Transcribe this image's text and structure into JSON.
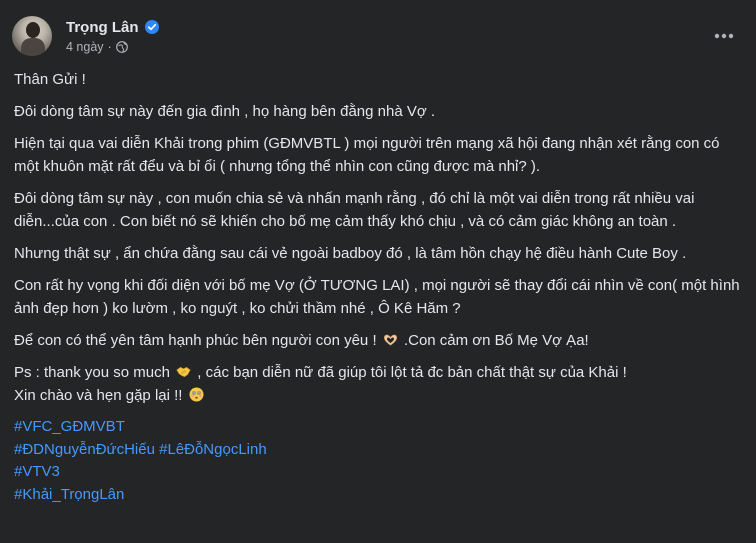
{
  "post": {
    "author_name": "Trọng Lân",
    "timestamp": "4 ngày",
    "separator": "·",
    "icons": {
      "verified": "verified-badge-icon",
      "audience": "globe-icon",
      "more": "more-horizontal-icon"
    },
    "colors": {
      "background": "#242526",
      "text": "#e4e6eb",
      "secondary_text": "#b0b3b8",
      "hashtag": "#4599ff",
      "verified": "#2d88ff"
    },
    "paragraphs": [
      "Thân Gửi !",
      "Đôi dòng tâm sự này đến gia đình , họ hàng bên đằng nhà Vợ .",
      "Hiện tại qua vai diễn Khải trong phim (GĐMVBTL ) mọi người trên mạng xã hội đang nhận xét rằng con có một khuôn mặt rất đểu và bỉ ổi ( nhưng tổng thể nhìn con cũng được mà nhỉ? ).",
      "Đôi dòng tâm sự này , con muốn chia sẻ và nhấn mạnh rằng , đó chỉ là một vai diễn trong rất nhiều vai diễn...của con . Con biết nó sẽ khiến cho bố mẹ cảm thấy khó chịu , và có cảm giác không an toàn .",
      "Nhưng thật sự , ẩn chứa đằng sau cái vẻ ngoài badboy đó , là tâm hồn chạy hệ điều hành Cute Boy .",
      "Con rất hy vọng khi đối diện với bố mẹ Vợ (Ở TƯƠNG LAI) , mọi người sẽ thay đổi cái nhìn về con( một hình ảnh đẹp hơn ) ko lườm , ko nguýt , ko chửi thầm nhé , Ô Kê Hăm ?"
    ],
    "para_thanks_before": "Để con có thể yên tâm hạnh phúc bên người con yêu !",
    "para_thanks_after": ".Con cảm ơn Bố Mẹ Vợ Ạa!",
    "para_ps_before": "Ps : thank you so much",
    "para_ps_middle": ", các bạn diễn nữ đã giúp tôi lột tả đc bản chất thật sự của Khải !",
    "para_ps_line2": "Xin chào và hẹn gặp lại !!",
    "emojis": {
      "heart_hands": "heart-hands-emoji",
      "handshake": "handshake-emoji",
      "flushed": "flushed-face-emoji"
    },
    "hashtags": [
      "#VFC_GĐMVBT",
      "#ĐDNguyễnĐứcHiếu #LêĐỗNgọcLinh",
      "#VTV3",
      "#Khải_TrọngLân"
    ]
  }
}
